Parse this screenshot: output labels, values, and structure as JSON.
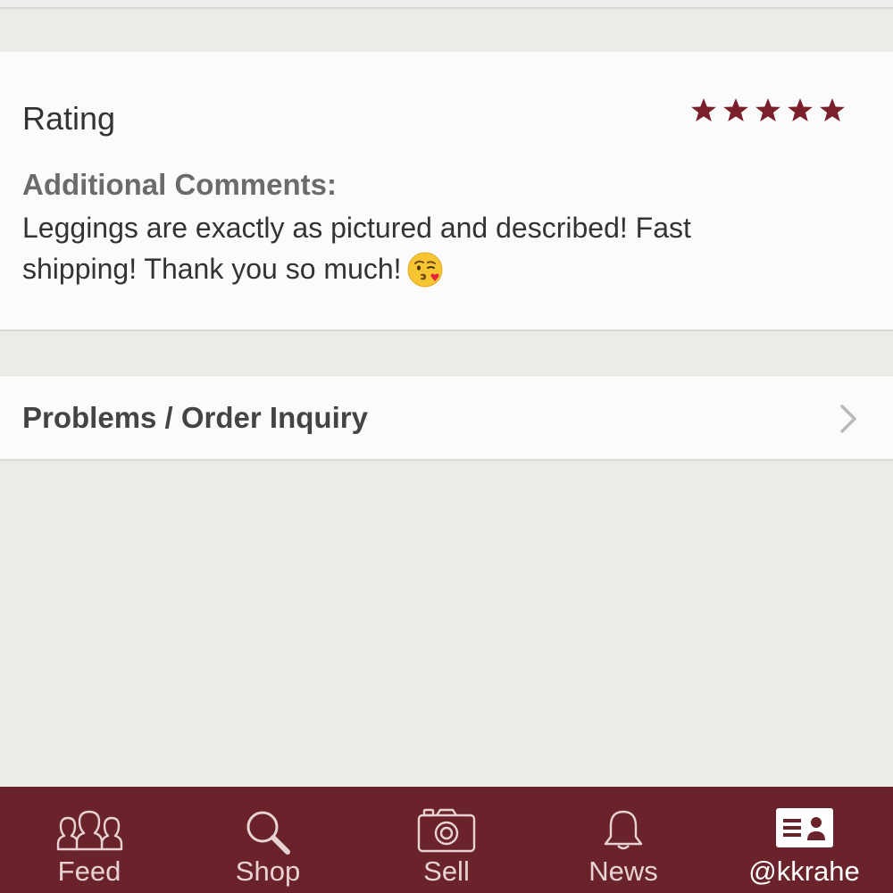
{
  "rating": {
    "title": "Rating",
    "stars": 5,
    "max_stars": 5,
    "star_color": "#7b1f2b"
  },
  "comments": {
    "label": "Additional Comments:",
    "text": "Leggings are exactly as pictured and described! Fast shipping! Thank you so much!",
    "emoji": "kissing-heart-emoji"
  },
  "problems": {
    "label": "Problems / Order Inquiry",
    "icon": "chevron-right-icon"
  },
  "tabbar": {
    "background": "#6a232b",
    "tabs": [
      {
        "label": "Feed",
        "icon": "people-icon",
        "active": false
      },
      {
        "label": "Shop",
        "icon": "search-icon",
        "active": false
      },
      {
        "label": "Sell",
        "icon": "camera-icon",
        "active": false
      },
      {
        "label": "News",
        "icon": "bell-icon",
        "active": false
      },
      {
        "label": "@kkrahe",
        "icon": "profile-card-icon",
        "active": true
      }
    ]
  }
}
